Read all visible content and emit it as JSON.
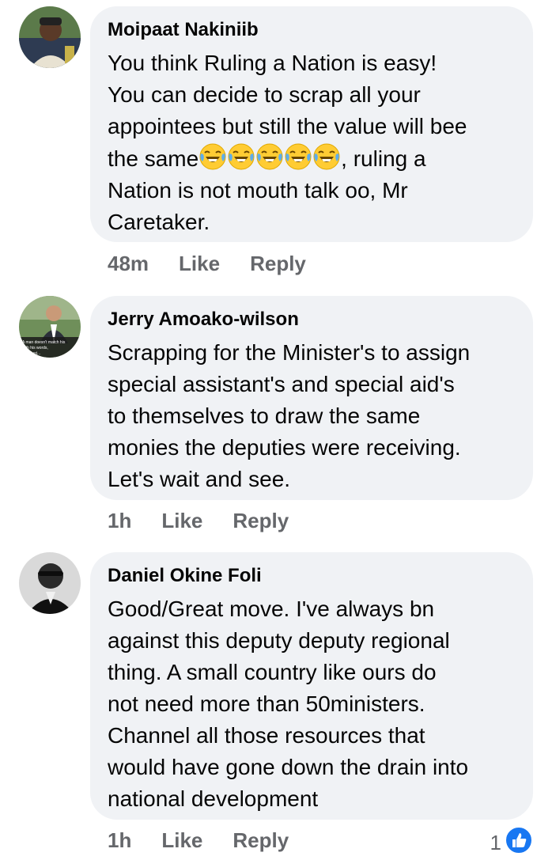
{
  "comments": [
    {
      "name": "Moipaat Nakiniib",
      "lines": [
        "You think Ruling a Nation is easy!",
        "You can decide to scrap all your",
        "appointees but still the value will bee",
        "the same",
        ", ruling a",
        "Nation is not mouth talk oo, Mr",
        "Caretaker."
      ],
      "time": "48m",
      "like": "Like",
      "reply": "Reply"
    },
    {
      "name": "Jerry Amoako-wilson",
      "avatar_caption": "A man doesn't match his with his words, He's just...",
      "lines": [
        "Scrapping for the Minister's to assign",
        "special assistant's and special aid's",
        "to themselves to draw the same",
        "monies the deputies were receiving.",
        "Let's wait and see."
      ],
      "time": "1h",
      "like": "Like",
      "reply": "Reply"
    },
    {
      "name": "Daniel Okine Foli",
      "lines": [
        "Good/Great move. I've always bn",
        "against this deputy deputy regional",
        "thing. A small country like ours do",
        "not need more than 50ministers.",
        "Channel all those resources that",
        "would have gone down the drain into",
        "national development"
      ],
      "time": "1h",
      "like": "Like",
      "reply": "Reply",
      "reaction_count": "1"
    }
  ],
  "colors": {
    "bubble": "#f0f2f5",
    "text": "#050505",
    "meta": "#65676b",
    "like_blue": "#1877f2"
  },
  "icons": {
    "emoji": "laughing-tears-emoji-icon",
    "reaction": "thumbs-up-icon"
  }
}
